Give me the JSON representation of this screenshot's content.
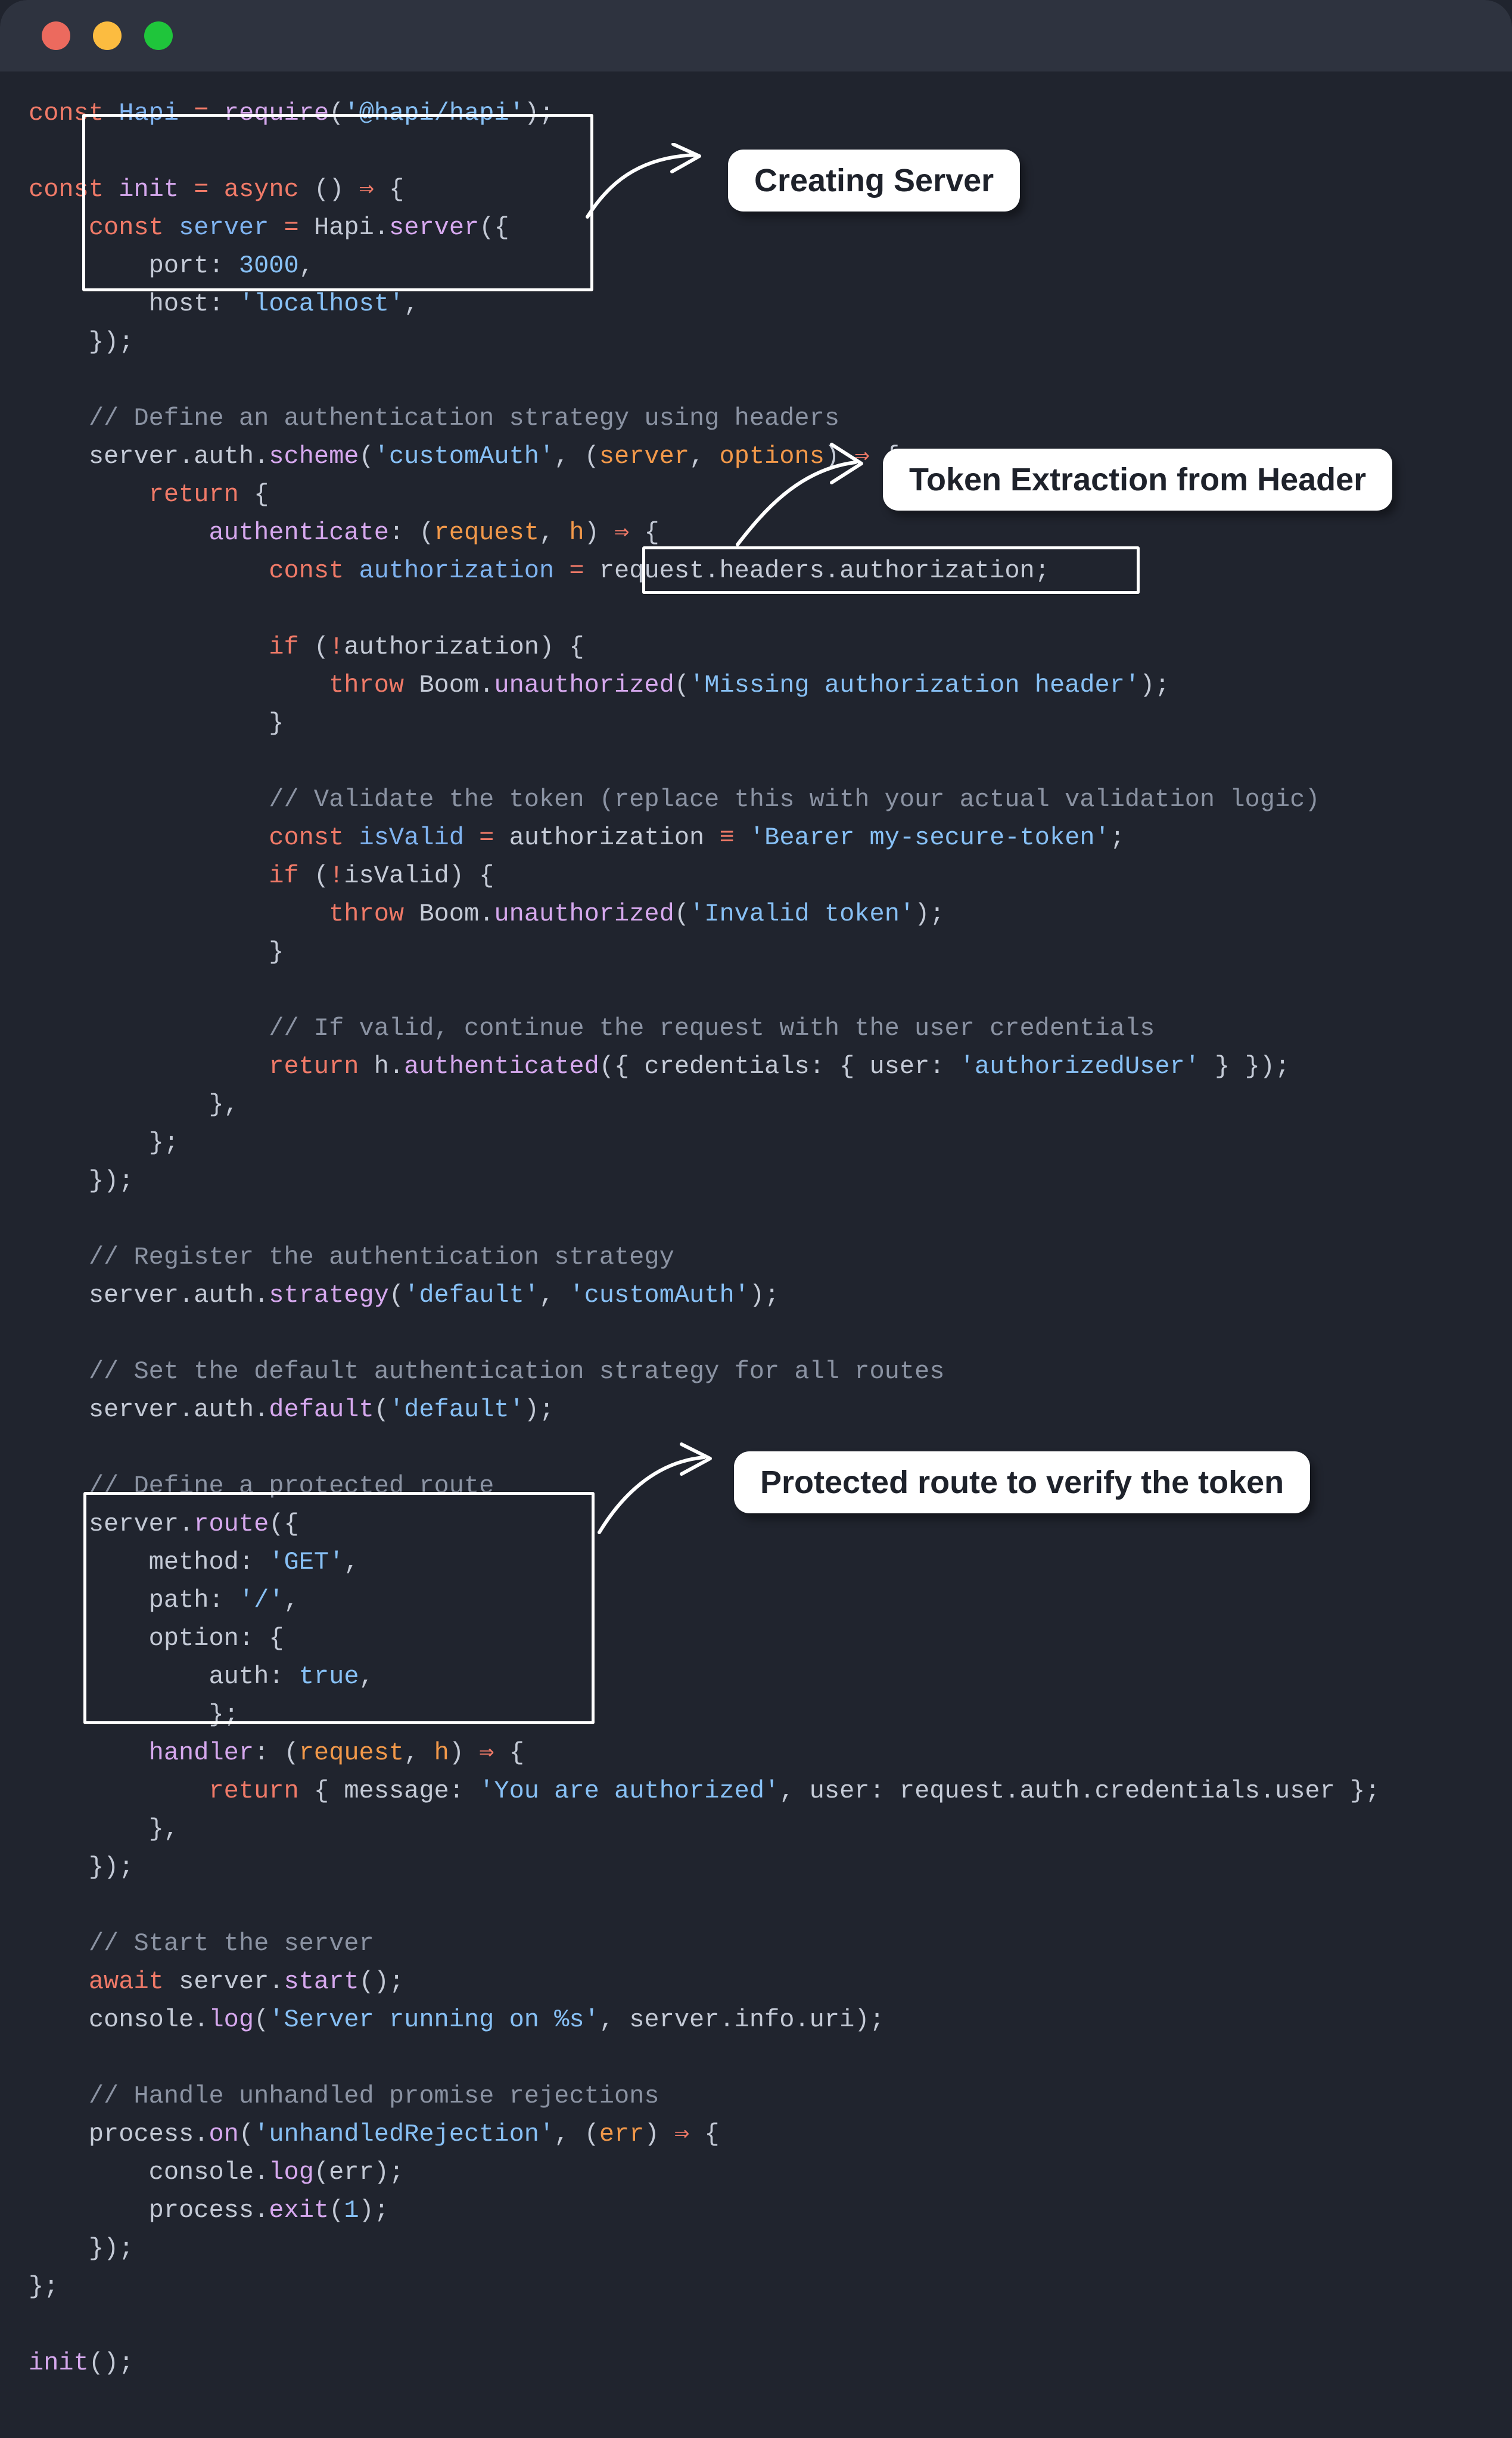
{
  "window": {
    "traffic_lights": [
      {
        "name": "close",
        "color": "#ec6a5e"
      },
      {
        "name": "minimize",
        "color": "#fcbc40"
      },
      {
        "name": "maximize",
        "color": "#1fc53b"
      }
    ],
    "background": "#20242e",
    "titlebar_background": "#2e333f"
  },
  "callouts": {
    "creating_server": "Creating Server",
    "token_extraction": "Token Extraction from Header",
    "protected_route": "Protected route to verify the token"
  },
  "code": {
    "language": "javascript",
    "lines": [
      "const Hapi = require('@hapi/hapi');",
      "",
      "const init = async () ⇒ {",
      "    const server = Hapi.server({",
      "        port: 3000,",
      "        host: 'localhost',",
      "    });",
      "",
      "    // Define an authentication strategy using headers",
      "    server.auth.scheme('customAuth', (server, options) ⇒ {",
      "        return {",
      "            authenticate: (request, h) ⇒ {",
      "                const authorization = request.headers.authorization;",
      "",
      "                if (!authorization) {",
      "                    throw Boom.unauthorized('Missing authorization header');",
      "                }",
      "",
      "                // Validate the token (replace this with your actual validation logic)",
      "                const isValid = authorization ≡ 'Bearer my-secure-token';",
      "                if (!isValid) {",
      "                    throw Boom.unauthorized('Invalid token');",
      "                }",
      "",
      "                // If valid, continue the request with the user credentials",
      "                return h.authenticated({ credentials: { user: 'authorizedUser' } });",
      "            },",
      "        };",
      "    });",
      "",
      "    // Register the authentication strategy",
      "    server.auth.strategy('default', 'customAuth');",
      "",
      "    // Set the default authentication strategy for all routes",
      "    server.auth.default('default');",
      "",
      "    // Define a protected route",
      "    server.route({",
      "        method: 'GET',",
      "        path: '/',",
      "        option: {",
      "            auth: true,",
      "            };",
      "        handler: (request, h) ⇒ {",
      "            return { message: 'You are authorized', user: request.auth.credentials.user };",
      "        },",
      "    });",
      "",
      "    // Start the server",
      "    await server.start();",
      "    console.log('Server running on %s', server.info.uri);",
      "",
      "    // Handle unhandled promise rejections",
      "    process.on('unhandledRejection', (err) ⇒ {",
      "        console.log(err);",
      "        process.exit(1);",
      "    });",
      "};",
      "",
      "init();"
    ],
    "colors": {
      "keyword": "#f07a68",
      "variable": "#7fb3f0",
      "function": "#d6a8ee",
      "string": "#87c0f5",
      "comment": "#8b93a3",
      "plain": "#c4cad6",
      "param": "#f2994a"
    }
  },
  "highlights": [
    {
      "name": "server-creation-box",
      "target": "const server = Hapi.server({ ... });"
    },
    {
      "name": "token-extraction-box",
      "target": "request.headers.authorization;"
    },
    {
      "name": "protected-route-box",
      "target": "server.route({ ... };"
    }
  ]
}
